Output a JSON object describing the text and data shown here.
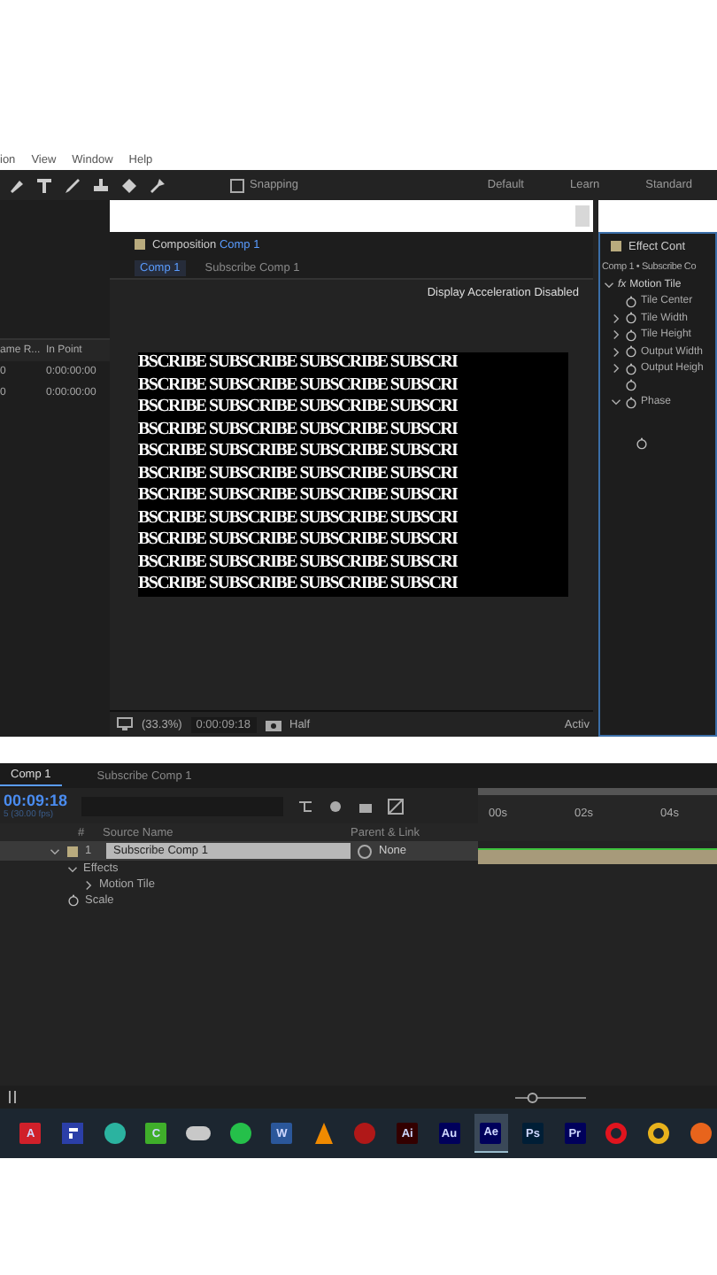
{
  "menu": [
    "ion",
    "View",
    "Window",
    "Help"
  ],
  "toolbar": {
    "snapping": {
      "label": "Snapping",
      "checked": false
    },
    "workspaces": [
      {
        "label": "Default",
        "selected": false
      },
      {
        "label": "Learn",
        "selected": false
      },
      {
        "label": "Standard",
        "selected": false
      }
    ]
  },
  "project_panel": {
    "columns": [
      "ame R...",
      "In Point"
    ],
    "rows": [
      [
        "0",
        "0:00:00:00"
      ],
      [
        "0",
        "0:00:00:00"
      ]
    ]
  },
  "composition": {
    "title": "Composition",
    "comp": "Comp 1",
    "breadcrumbs": [
      {
        "label": "Comp 1",
        "selected": true
      },
      {
        "label": "Subscribe Comp 1",
        "selected": false
      }
    ],
    "notice": "Display Acceleration Disabled",
    "preview_lines": [
      "BSCRIBE SUBSCRIBE SUBSCRIBE SUBSCRI",
      "BSCRIBE SUBSCRIBE SUBSCRIBE SUBSCRI",
      "BSCRIBE SUBSCRIBE SUBSCRIBE SUBSCRI",
      "BSCRIBE SUBSCRIBE SUBSCRIBE SUBSCRI",
      "BSCRIBE SUBSCRIBE SUBSCRIBE SUBSCRI",
      "BSCRIBE SUBSCRIBE SUBSCRIBE SUBSCRI",
      "BSCRIBE SUBSCRIBE SUBSCRIBE SUBSCRI",
      "BSCRIBE SUBSCRIBE SUBSCRIBE SUBSCRI",
      "BSCRIBE SUBSCRIBE SUBSCRIBE SUBSCRI",
      "BSCRIBE SUBSCRIBE SUBSCRIBE SUBSCRI",
      "BSCRIBE SUBSCRIBE SUBSCRIBE SUBSCRI"
    ],
    "zoom": "(33.3%)",
    "time": "0:00:09:18",
    "resolution": "Half",
    "camera": "Activ"
  },
  "effect_controls": {
    "title": "Effect Cont",
    "subtitle": "Comp 1 • Subscribe Co",
    "effect_icon": "fx",
    "effect": "Motion Tile",
    "properties": [
      {
        "kind": "plain",
        "label": "Tile Center"
      },
      {
        "kind": "closed",
        "label": "Tile Width"
      },
      {
        "kind": "closed",
        "label": "Tile Height"
      },
      {
        "kind": "closed",
        "label": "Output Width"
      },
      {
        "kind": "closed",
        "label": "Output Heigh"
      },
      {
        "kind": "blank"
      },
      {
        "kind": "open",
        "label": "Phase"
      }
    ]
  },
  "timeline": {
    "tabs": [
      {
        "label": "Comp 1",
        "selected": true
      },
      {
        "label": "Subscribe Comp 1",
        "selected": false
      }
    ],
    "time": "00:09:18",
    "fps": "5 (30.00 fps)",
    "columns": [
      "#",
      "Source Name",
      "Parent & Link"
    ],
    "layer": {
      "number": "1",
      "name": "Subscribe Comp 1",
      "parent": "None"
    },
    "children": [
      {
        "label": "Effects",
        "expanded": true,
        "children": [
          {
            "label": "Motion Tile",
            "expanded": false
          }
        ]
      },
      {
        "label": "Scale",
        "kind": "property"
      }
    ],
    "ruler": [
      "00s",
      "02s",
      "04s"
    ],
    "zoom_slider": {
      "level": 0.2
    }
  },
  "taskbar": [
    {
      "kind": "letter",
      "label": "A",
      "color": "#d0202a",
      "selected": false
    },
    {
      "kind": "square",
      "color": "#2b3fa8",
      "selected": false
    },
    {
      "kind": "circle",
      "color": "#2bb3a0",
      "selected": false
    },
    {
      "kind": "letter",
      "label": "C",
      "color": "#3fae2a",
      "selected": false
    },
    {
      "kind": "pill",
      "color": "#c8c8c8",
      "selected": false
    },
    {
      "kind": "circle",
      "color": "#25c04a",
      "selected": false
    },
    {
      "kind": "letter",
      "label": "W",
      "color": "#2b579a",
      "selected": false
    },
    {
      "kind": "cone",
      "color": "#f08a00",
      "selected": false
    },
    {
      "kind": "circle",
      "color": "#b01818",
      "selected": false
    },
    {
      "kind": "letter",
      "label": "Ai",
      "color": "#330000",
      "selected": false
    },
    {
      "kind": "letter",
      "label": "Au",
      "color": "#00005b",
      "selected": false
    },
    {
      "kind": "letter",
      "label": "Ae",
      "color": "#00005b",
      "selected": true
    },
    {
      "kind": "letter",
      "label": "Ps",
      "color": "#001e36",
      "selected": false
    },
    {
      "kind": "letter",
      "label": "Pr",
      "color": "#00005b",
      "selected": false
    },
    {
      "kind": "ring",
      "color": "#e0141e",
      "selected": false
    },
    {
      "kind": "ring",
      "color": "#e8b21c",
      "selected": false
    },
    {
      "kind": "circle",
      "color": "#e8641c",
      "selected": false
    }
  ]
}
